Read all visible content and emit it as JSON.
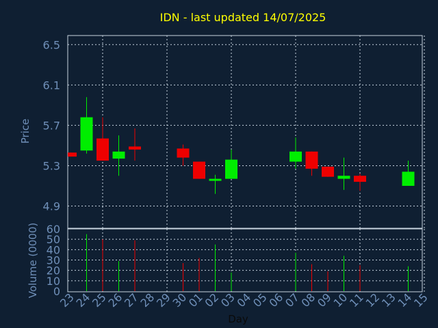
{
  "chart_data": {
    "type": "candlestick",
    "title": "IDN - last updated 14/07/2025",
    "xlabel": "Day",
    "price_panel": {
      "ylabel": "Price",
      "yticks": [
        "6.5",
        "6.1",
        "5.7",
        "5.3",
        "4.9"
      ],
      "ylim": [
        4.68,
        6.59
      ],
      "grid": true
    },
    "volume_panel": {
      "ylabel": "Volume (0000)",
      "yticks": [
        "60",
        "50",
        "40",
        "30",
        "20",
        "10",
        "0"
      ],
      "ylim": [
        0,
        60
      ],
      "grid": true
    },
    "x_labels": [
      "23",
      "24",
      "25",
      "26",
      "27",
      "28",
      "29",
      "30",
      "01",
      "02",
      "03",
      "04",
      "05",
      "06",
      "07",
      "08",
      "09",
      "10",
      "11",
      "12",
      "13",
      "14",
      "15"
    ],
    "candles": [
      {
        "day": "23",
        "open": 5.43,
        "close": 5.39,
        "high": 5.43,
        "low": 5.39,
        "volume": 0
      },
      {
        "day": "24",
        "open": 5.45,
        "close": 5.78,
        "high": 5.98,
        "low": 5.42,
        "volume": 55
      },
      {
        "day": "25",
        "open": 5.57,
        "close": 5.35,
        "high": 5.78,
        "low": 5.35,
        "volume": 50
      },
      {
        "day": "26",
        "open": 5.37,
        "close": 5.44,
        "high": 5.6,
        "low": 5.2,
        "volume": 29
      },
      {
        "day": "27",
        "open": 5.49,
        "close": 5.46,
        "high": 5.67,
        "low": 5.35,
        "volume": 49
      },
      {
        "day": "30",
        "open": 5.47,
        "close": 5.38,
        "high": 5.51,
        "low": 5.3,
        "volume": 27
      },
      {
        "day": "01",
        "open": 5.34,
        "close": 5.17,
        "high": 5.34,
        "low": 5.17,
        "volume": 32
      },
      {
        "day": "02",
        "open": 5.16,
        "close": 5.17,
        "high": 5.21,
        "low": 5.02,
        "volume": 45
      },
      {
        "day": "03",
        "open": 5.17,
        "close": 5.36,
        "high": 5.46,
        "low": 5.17,
        "volume": 18
      },
      {
        "day": "07",
        "open": 5.34,
        "close": 5.44,
        "high": 5.58,
        "low": 5.27,
        "volume": 37
      },
      {
        "day": "08",
        "open": 5.44,
        "close": 5.27,
        "high": 5.44,
        "low": 5.2,
        "volume": 26
      },
      {
        "day": "09",
        "open": 5.29,
        "close": 5.19,
        "high": 5.29,
        "low": 5.19,
        "volume": 19
      },
      {
        "day": "10",
        "open": 5.17,
        "close": 5.2,
        "high": 5.38,
        "low": 5.06,
        "volume": 34
      },
      {
        "day": "11",
        "open": 5.2,
        "close": 5.14,
        "high": 5.22,
        "low": 5.05,
        "volume": 25
      },
      {
        "day": "14",
        "open": 5.1,
        "close": 5.24,
        "high": 5.35,
        "low": 5.1,
        "volume": 24
      }
    ],
    "colors": {
      "up": "#00ee00",
      "down": "#ee0000",
      "title": "#ffff00",
      "axis_text": "#6f8fb8",
      "grid": "#c8d4e0",
      "background": "#0f1f32"
    }
  }
}
